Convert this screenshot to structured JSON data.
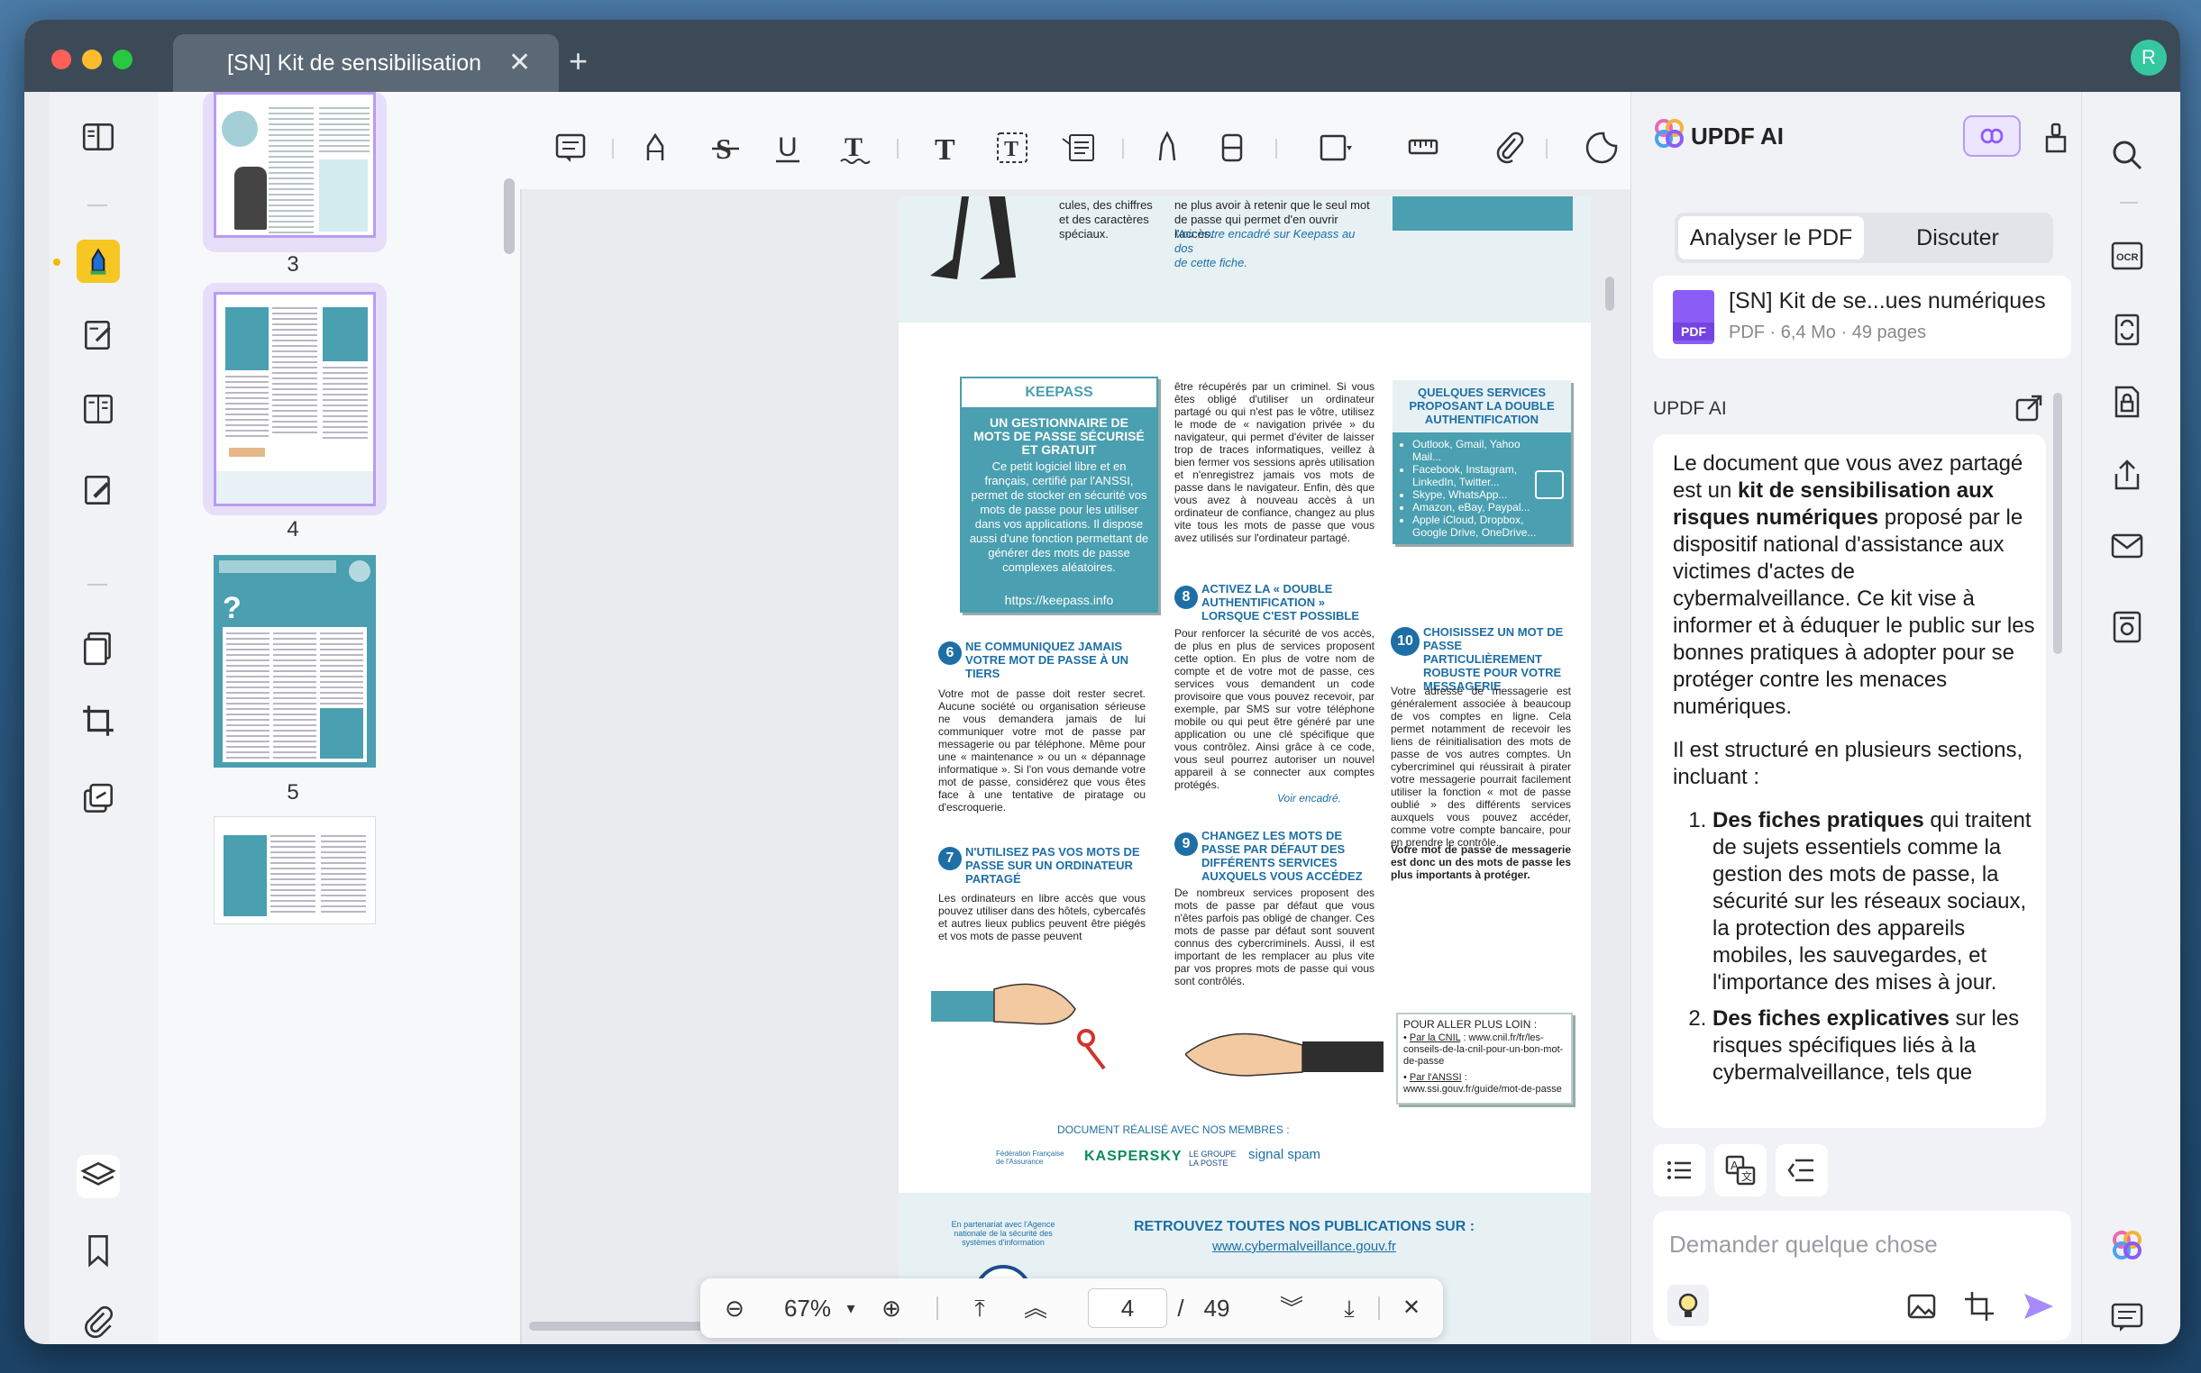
{
  "window": {
    "tab_title": "[SN] Kit de sensibilisation",
    "avatar_letter": "R"
  },
  "thumbnails": [
    {
      "label": "3"
    },
    {
      "label": "4"
    },
    {
      "label": "5"
    }
  ],
  "document": {
    "top_fragment_left": "cules, des chiffres\net des caractères\nspéciaux.",
    "top_fragment_right": "ne plus avoir à retenir que le seul mot\nde passe qui permet d'en ouvrir l'accès.",
    "top_fragment_right_italic": "Voir notre encadré sur Keepass au dos\nde cette fiche.",
    "keepass": {
      "title": "KEEPASS",
      "subtitle": "UN GESTIONNAIRE DE MOTS DE PASSE SÉCURISÉ ET GRATUIT",
      "body": "Ce petit logiciel libre et en français, certifié par l'ANSSI, permet de stocker en sécurité vos mots de passe pour les utiliser dans vos applications. Il dispose aussi d'une fonction permettant de générer des mots de passe complexes aléatoires.",
      "url": "https://keepass.info"
    },
    "col2_intro": "être récupérés par un criminel. Si vous êtes obligé d'utiliser un ordinateur partagé ou qui n'est pas le vôtre, utilisez le mode de « navigation privée » du navigateur, qui permet d'éviter de laisser trop de traces informatiques, veillez à bien fermer vos sessions après utilisation et n'enregistrez jamais vos mots de passe dans le navigateur. Enfin, dès que vous avez à nouveau accès à un ordinateur de confiance, changez au plus vite tous les mots de passe que vous avez utilisés sur l'ordinateur partagé.",
    "services": {
      "title": "QUELQUES SERVICES PROPOSANT LA DOUBLE AUTHENTIFICATION",
      "items": [
        "Outlook, Gmail, Yahoo Mail...",
        "Facebook, Instagram, LinkedIn, Twitter...",
        "Skype, WhatsApp...",
        "Amazon, eBay, Paypal...",
        "Apple iCloud, Dropbox, Google Drive, OneDrive..."
      ]
    },
    "s6": {
      "num": "6",
      "title": "NE COMMUNIQUEZ JAMAIS VOTRE MOT DE PASSE À UN TIERS",
      "body": "Votre mot de passe doit rester secret. Aucune société ou organisation sérieuse ne vous demandera jamais de lui communiquer votre mot de passe par messagerie ou par téléphone. Même pour une « maintenance » ou un « dépannage informatique ». Si l'on vous demande votre mot de passe, considérez que vous êtes face à une tentative de piratage ou d'escroquerie."
    },
    "s7": {
      "num": "7",
      "title": "N'UTILISEZ PAS VOS MOTS DE PASSE SUR UN ORDINATEUR PARTAGÉ",
      "body": "Les ordinateurs en libre accès que vous pouvez utiliser dans des hôtels, cybercafés et autres lieux publics peuvent être piégés et vos mots de passe peuvent"
    },
    "s8": {
      "num": "8",
      "title": "ACTIVEZ LA « DOUBLE AUTHENTIFICATION » LORSQUE C'EST POSSIBLE",
      "body": "Pour renforcer la sécurité de vos accès, de plus en plus de services proposent cette option. En plus de votre nom de compte et de votre mot de passe, ces services vous demandent un code provisoire que vous pouvez recevoir, par exemple, par SMS sur votre téléphone mobile ou qui peut être généré par une application ou une clé spécifique que vous contrôlez. Ainsi grâce à ce code, vous seul pourrez autoriser un nouvel appareil à se connecter aux comptes protégés.",
      "link": "Voir encadré."
    },
    "s9": {
      "num": "9",
      "title": "CHANGEZ LES MOTS DE PASSE PAR DÉFAUT DES DIFFÉRENTS SERVICES AUXQUELS VOUS ACCÉDEZ",
      "body": "De nombreux services proposent des mots de passe par défaut que vous n'êtes parfois pas obligé de changer. Ces mots de passe par défaut sont souvent connus des cybercriminels. Aussi, il est important de les remplacer au plus vite par vos propres mots de passe qui vous sont contrôlés."
    },
    "s10": {
      "num": "10",
      "title": "CHOISISSEZ UN MOT DE PASSE PARTICULIÈREMENT ROBUSTE POUR VOTRE MESSAGERIE",
      "body": "Votre adresse de messagerie est généralement associée à beaucoup de vos comptes en ligne. Cela permet notamment de recevoir les liens de réinitialisation des mots de passe de vos autres comptes. Un cybercriminel qui réussirait à pirater votre messagerie pourrait facilement utiliser la fonction « mot de passe oublié » des différents services auxquels vous pouvez accéder, comme votre compte bancaire, pour en prendre le contrôle.",
      "bold": "Votre mot de passe de messagerie est donc un des mots de passe les plus importants à protéger."
    },
    "further": {
      "title": "POUR ALLER PLUS LOIN :",
      "cnil_label": "Par la CNIL",
      "cnil_url": ": www.cnil.fr/fr/les-conseils-de-la-cnil-pour-un-bon-mot-de-passe",
      "anssi_label": "Par l'ANSSI",
      "anssi_url": ": www.ssi.gouv.fr/guide/mot-de-passe"
    },
    "members_label": "DOCUMENT RÉALISÉ AVEC NOS MEMBRES :",
    "members": [
      "Fédération Française de l'Assurance",
      "KASPERSKY",
      "LE GROUPE LA POSTE",
      "signal spam"
    ],
    "partner": "En partenariat avec l'Agence nationale de la sécurité des systèmes d'information",
    "footer_title": "RETROUVEZ TOUTES NOS PUBLICATIONS SUR :",
    "footer_url": "www.cybermalveillance.gouv.fr"
  },
  "zoombar": {
    "zoom": "67%",
    "current_page": "4",
    "separator": "/",
    "total_pages": "49"
  },
  "ai_panel": {
    "title": "UPDF AI",
    "tab_analyze": "Analyser le PDF",
    "tab_discuss": "Discuter",
    "file_name": "[SN] Kit de se...ues numériques",
    "file_meta": "PDF · 6,4 Mo · 49 pages",
    "section_label": "UPDF AI",
    "msg_p1_pre": "Le document que vous avez partagé est un ",
    "msg_p1_bold": "kit de sensibilisation aux risques numériques",
    "msg_p1_post": " proposé par le dispositif national d'assistance aux victimes d'actes de cybermalveillance. Ce kit vise à informer et à éduquer le public sur les bonnes pratiques à adopter pour se protéger contre les menaces numériques.",
    "msg_p2": "Il est structuré en plusieurs sections, incluant :",
    "li1_bold": "Des fiches pratiques",
    "li1_text": " qui traitent de sujets essentiels comme la gestion des mots de passe, la sécurité sur les réseaux sociaux, la protection des appareils mobiles, les sauvegardes, et l'importance des mises à jour.",
    "li2_bold": "Des fiches explicatives",
    "li2_text": " sur les risques spécifiques liés à la cybermalveillance, tels que",
    "input_placeholder": "Demander quelque chose"
  },
  "colors": {
    "accent": "#8b5cf6",
    "teal": "#4a9fb0",
    "doc_blue": "#1d6fa5",
    "titlebar": "#3c4a58"
  }
}
